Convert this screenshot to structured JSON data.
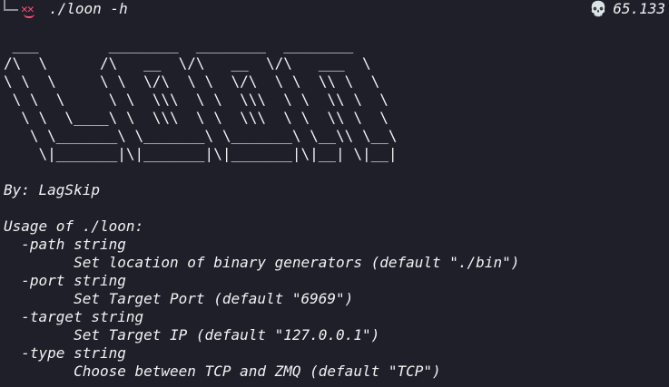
{
  "prompt": {
    "command": "./loon -h",
    "status_icon": "skull-icon",
    "status_value": "65.133",
    "accent": "#ff4d6d"
  },
  "banner": [
    " ___        ________  ________  ________",
    "/\\  \\      /\\   __  \\/\\   __  \\/\\   ___  \\",
    "\\ \\  \\     \\ \\  \\/\\  \\ \\  \\/\\  \\ \\  \\\\ \\  \\",
    " \\ \\  \\     \\ \\  \\\\\\  \\ \\  \\\\\\  \\ \\  \\\\ \\  \\",
    "  \\ \\  \\____\\ \\  \\\\\\  \\ \\  \\\\\\  \\ \\  \\\\ \\  \\",
    "   \\ \\_______\\ \\_______\\ \\_______\\ \\__\\\\ \\__\\",
    "    \\|_______|\\|_______|\\|_______|\\|__| \\|__|"
  ],
  "author": "By: LagSkip",
  "usage": [
    "Usage of ./loon:",
    "  -path string",
    "        Set location of binary generators (default \"./bin\")",
    "  -port string",
    "        Set Target Port (default \"6969\")",
    "  -target string",
    "        Set Target IP (default \"127.0.0.1\")",
    "  -type string",
    "        Choose between TCP and ZMQ (default \"TCP\")"
  ]
}
